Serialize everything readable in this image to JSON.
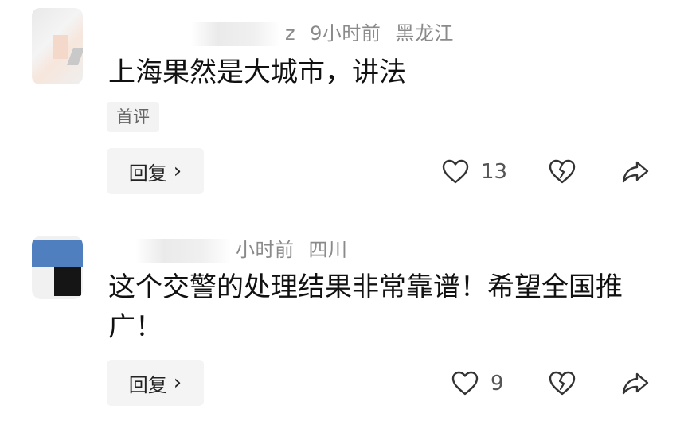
{
  "comments": [
    {
      "meta": {
        "name_suffix": "z",
        "time": "9小时前",
        "location": "黑龙江"
      },
      "text": "上海果然是大城市，讲法",
      "tag": "首评",
      "reply_label": "回复",
      "like_count": "13",
      "icons": [
        "heart-icon",
        "broken-heart-icon",
        "share-icon",
        "chevron-right-icon"
      ]
    },
    {
      "meta": {
        "time": "小时前",
        "location": "四川"
      },
      "text": "这个交警的处理结果非常靠谱！希望全国推广！",
      "reply_label": "回复",
      "like_count": "9",
      "icons": [
        "heart-icon",
        "broken-heart-icon",
        "share-icon",
        "chevron-right-icon"
      ]
    }
  ]
}
